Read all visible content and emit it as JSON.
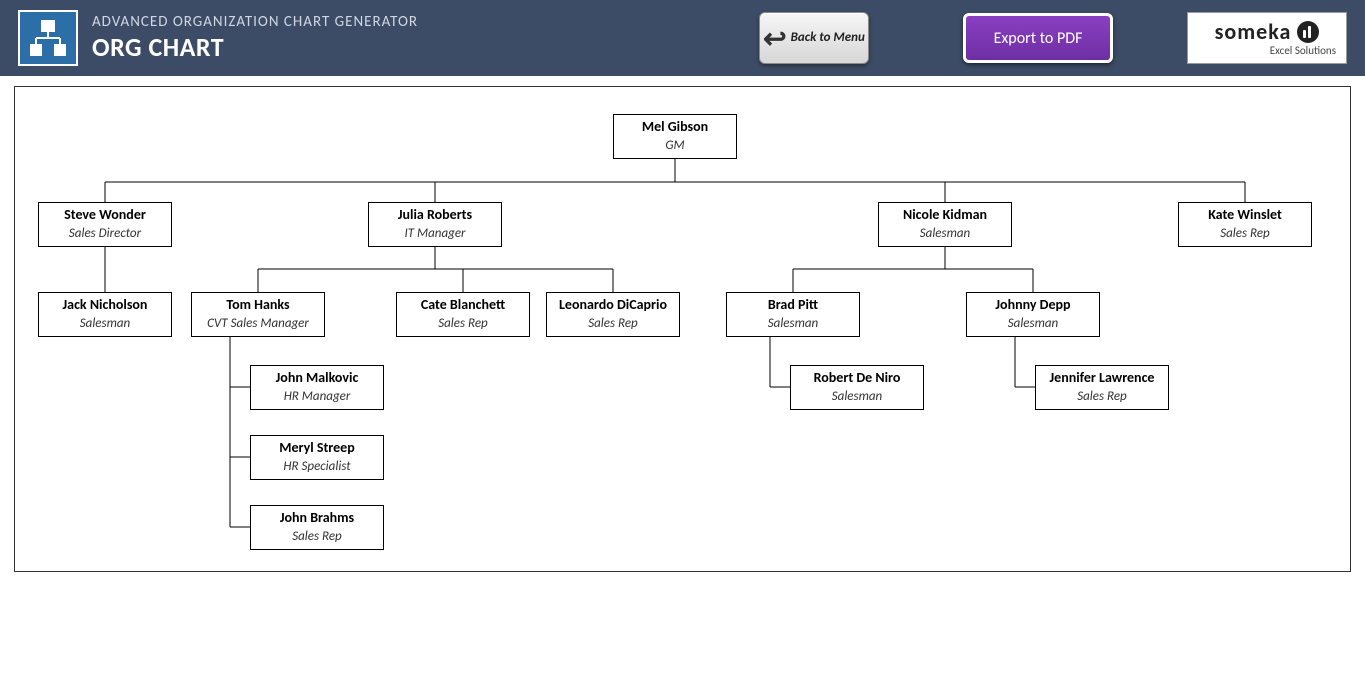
{
  "header": {
    "subtitle": "ADVANCED ORGANIZATION CHART GENERATOR",
    "title": "ORG CHART",
    "back_label": "Back to Menu",
    "export_label": "Export to PDF",
    "brand_name": "someka",
    "brand_sub": "Excel Solutions"
  },
  "org": {
    "root": {
      "name": "Mel Gibson",
      "role": "GM"
    },
    "l2_steve": {
      "name": "Steve Wonder",
      "role": "Sales Director"
    },
    "l2_julia": {
      "name": "Julia Roberts",
      "role": "IT Manager"
    },
    "l2_nicole": {
      "name": "Nicole Kidman",
      "role": "Salesman"
    },
    "l2_kate": {
      "name": "Kate Winslet",
      "role": "Sales Rep"
    },
    "l3_jack": {
      "name": "Jack Nicholson",
      "role": "Salesman"
    },
    "l3_tom": {
      "name": "Tom Hanks",
      "role": "CVT Sales Manager"
    },
    "l3_cate": {
      "name": "Cate Blanchett",
      "role": "Sales Rep"
    },
    "l3_leo": {
      "name": "Leonardo DiCaprio",
      "role": "Sales Rep"
    },
    "l3_brad": {
      "name": "Brad Pitt",
      "role": "Salesman"
    },
    "l3_johnny": {
      "name": "Johnny Depp",
      "role": "Salesman"
    },
    "l4_john_m": {
      "name": "John Malkovic",
      "role": "HR Manager"
    },
    "l4_meryl": {
      "name": "Meryl Streep",
      "role": "HR Specialist"
    },
    "l4_john_b": {
      "name": "John Brahms",
      "role": "Sales Rep"
    },
    "l4_robert": {
      "name": "Robert De Niro",
      "role": "Salesman"
    },
    "l4_jennifer": {
      "name": "Jennifer Lawrence",
      "role": "Sales Rep"
    }
  }
}
